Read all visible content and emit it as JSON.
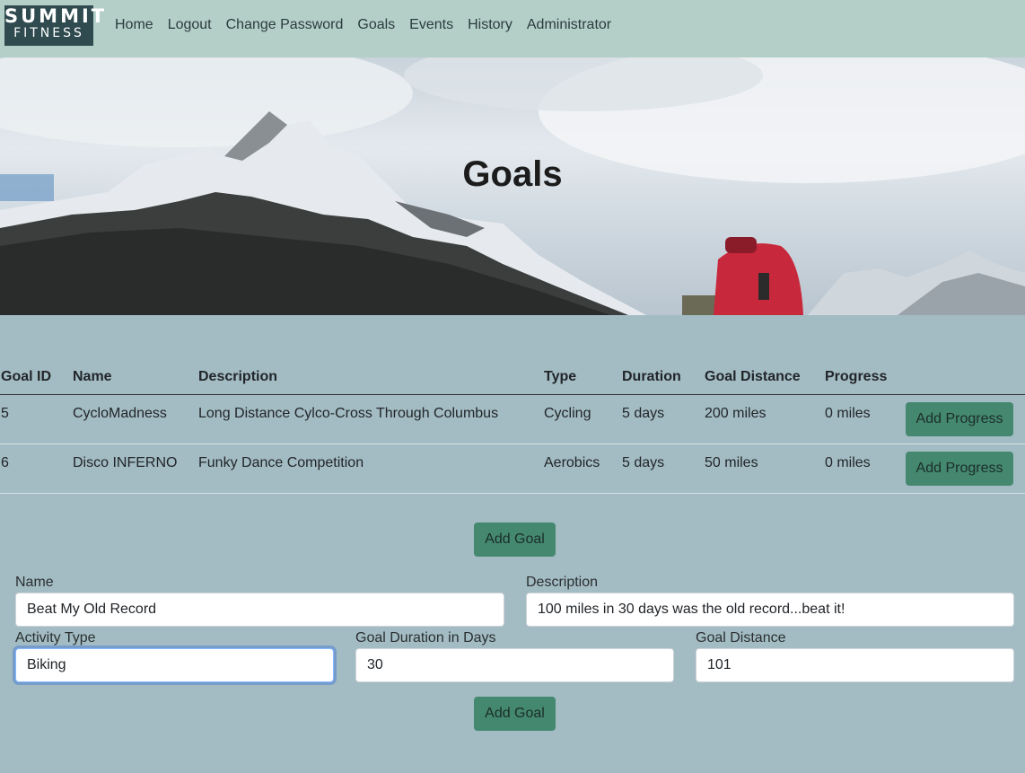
{
  "brand": {
    "line1": "SUMMIT",
    "line2": "FITNESS"
  },
  "nav": [
    "Home",
    "Logout",
    "Change Password",
    "Goals",
    "Events",
    "History",
    "Administrator"
  ],
  "hero": {
    "title": "Goals"
  },
  "table": {
    "headers": [
      "Goal ID",
      "Name",
      "Description",
      "Type",
      "Duration",
      "Goal Distance",
      "Progress"
    ],
    "rows": [
      {
        "id": "5",
        "name": "CycloMadness",
        "description": "Long Distance Cylco-Cross Through Columbus",
        "type": "Cycling",
        "duration": "5 days",
        "distance": "200 miles",
        "progress": "0 miles",
        "action": "Add Progress"
      },
      {
        "id": "6",
        "name": "Disco INFERNO",
        "description": "Funky Dance Competition",
        "type": "Aerobics",
        "duration": "5 days",
        "distance": "50 miles",
        "progress": "0 miles",
        "action": "Add Progress"
      }
    ]
  },
  "add_goal_toggle": "Add Goal",
  "form": {
    "name_label": "Name",
    "name_value": "Beat My Old Record",
    "description_label": "Description",
    "description_value": "100 miles in 30 days was the old record...beat it!",
    "activity_label": "Activity Type",
    "activity_value": "Biking",
    "duration_label": "Goal Duration in Days",
    "duration_value": "30",
    "distance_label": "Goal Distance",
    "distance_value": "101",
    "submit": "Add Goal"
  },
  "colors": {
    "navbar": "#b3cfc8",
    "page": "#a3bcc3",
    "button": "#44886f",
    "logo_bg": "#2f4b4f"
  }
}
